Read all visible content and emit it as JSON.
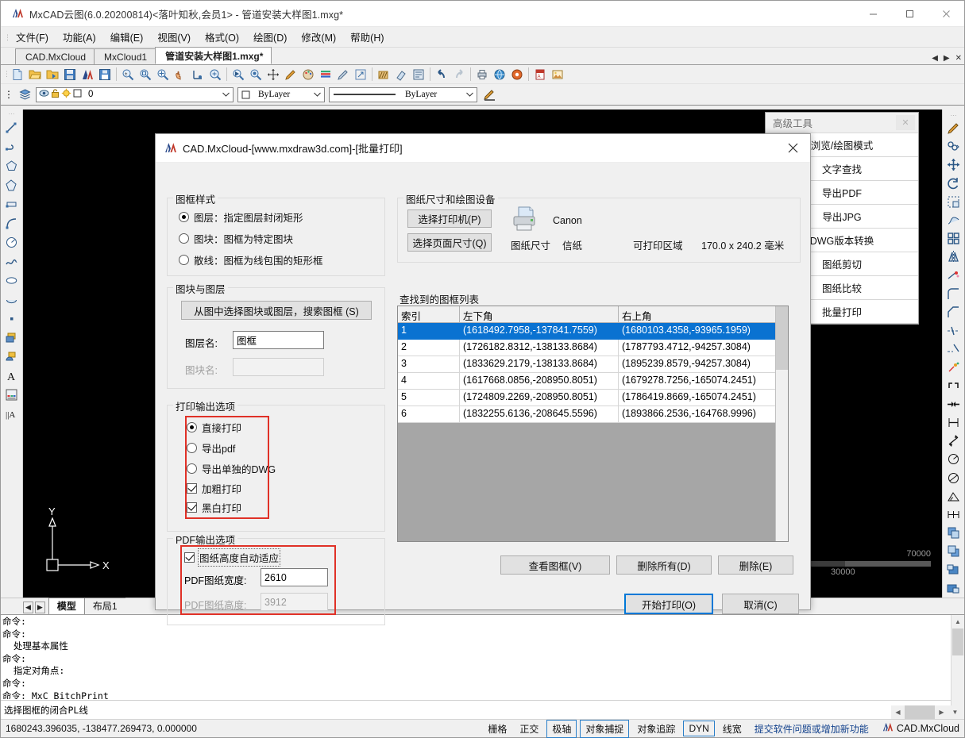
{
  "window": {
    "title": "MxCAD云图(6.0.20200814)<落叶知秋,会员1> - 管道安装大样图1.mxg*",
    "minimize": "—",
    "maximize": "□",
    "close": "✕"
  },
  "menubar": [
    {
      "label": "文件(F)"
    },
    {
      "label": "功能(A)"
    },
    {
      "label": "编辑(E)"
    },
    {
      "label": "视图(V)"
    },
    {
      "label": "格式(O)"
    },
    {
      "label": "绘图(D)"
    },
    {
      "label": "修改(M)"
    },
    {
      "label": "帮助(H)"
    }
  ],
  "doc_tabs": [
    {
      "label": "CAD.MxCloud",
      "active": false
    },
    {
      "label": "MxCloud1",
      "active": false
    },
    {
      "label": "管道安装大样图1.mxg*",
      "active": true
    }
  ],
  "tab_nav": {
    "prev": "◀",
    "next": "▶",
    "close": "✕"
  },
  "layer_toolbar": {
    "layer_value": "0",
    "color_value": "ByLayer",
    "linetype_value": "ByLayer",
    "dropdown_arrow": "⌄"
  },
  "advanced_panel": {
    "title": "高级工具",
    "close": "✕",
    "items": [
      {
        "label": "浏览/绘图模式"
      },
      {
        "label": "文字查找"
      },
      {
        "label": "导出PDF"
      },
      {
        "label": "导出JPG"
      },
      {
        "label": "DWG版本转换"
      },
      {
        "label": "图纸剪切"
      },
      {
        "label": "图纸比较"
      },
      {
        "label": "批量打印"
      }
    ]
  },
  "canvas": {
    "ucs_x": "X",
    "ucs_y": "Y",
    "scale_left": "000",
    "scale_right": "70000",
    "scale_mid": "30000"
  },
  "layout_tabs": {
    "nav_prev": "◀",
    "nav_next": "▶",
    "tabs": [
      {
        "label": "模型",
        "active": true
      },
      {
        "label": "布局1",
        "active": false
      }
    ]
  },
  "command_history": [
    "命令:",
    "命令:",
    "  处理基本属性",
    "命令:",
    "  指定对角点:",
    "命令:",
    "命令: MxC_BitchPrint",
    " 选择图框的闭合PL线"
  ],
  "statusbar": {
    "coordinates": "1680243.396035,  -138477.269473,  0.000000",
    "toggles": [
      {
        "label": "栅格",
        "boxed": false
      },
      {
        "label": "正交",
        "boxed": false
      },
      {
        "label": "极轴",
        "boxed": true
      },
      {
        "label": "对象捕捉",
        "boxed": true
      },
      {
        "label": "对象追踪",
        "boxed": false
      },
      {
        "label": "DYN",
        "boxed": true
      },
      {
        "label": "线宽",
        "boxed": false
      }
    ],
    "feedback_link": "提交软件问题或增加新功能",
    "brand": "CAD.MxCloud"
  },
  "dialog": {
    "title": "CAD.MxCloud-[www.mxdraw3d.com]-[批量打印]",
    "close": "✕",
    "frame_style": {
      "legend": "图框样式",
      "options": [
        {
          "label": "图层：指定图层封闭矩形",
          "selected": true
        },
        {
          "label": "图块：图框为特定图块",
          "selected": false
        },
        {
          "label": "散线：图框为线包围的矩形框",
          "selected": false
        }
      ]
    },
    "block_layer": {
      "legend": "图块与图层",
      "search_button": "从图中选择图块或图层，搜索图框 (S)",
      "layer_label": "图层名:",
      "layer_value": "图框",
      "block_label": "图块名:",
      "block_value": ""
    },
    "print_output": {
      "legend": "打印输出选项",
      "options": [
        {
          "type": "radio",
          "label": "直接打印",
          "checked": true
        },
        {
          "type": "radio",
          "label": "导出pdf",
          "checked": false
        },
        {
          "type": "radio",
          "label": "导出单独的DWG",
          "checked": false
        },
        {
          "type": "check",
          "label": "加粗打印",
          "checked": true
        },
        {
          "type": "check",
          "label": "黑白打印",
          "checked": true
        }
      ]
    },
    "pdf_output": {
      "legend": "PDF输出选项",
      "auto_height": {
        "label": "图纸高度自动适应",
        "checked": true
      },
      "width_label": "PDF图纸宽度:",
      "width_value": "2610",
      "height_label": "PDF图纸高度:",
      "height_value": "3912"
    },
    "paper_device": {
      "legend": "图纸尺寸和绘图设备",
      "select_printer_button": "选择打印机(P)",
      "select_pagesize_button": "选择页面尺寸(Q)",
      "printer_name": "Canon",
      "paper_size_label": "图纸尺寸",
      "paper_size_value": "信纸",
      "printable_area_label": "可打印区域",
      "printable_area_value": "170.0 x 240.2 毫米"
    },
    "frame_list": {
      "legend": "查找到的图框列表",
      "columns": [
        "索引",
        "左下角",
        "右上角"
      ],
      "rows": [
        {
          "index": "1",
          "lower_left": "(1618492.7958,-137841.7559)",
          "upper_right": "(1680103.4358,-93965.1959)",
          "selected": true
        },
        {
          "index": "2",
          "lower_left": "(1726182.8312,-138133.8684)",
          "upper_right": "(1787793.4712,-94257.3084)",
          "selected": false
        },
        {
          "index": "3",
          "lower_left": "(1833629.2179,-138133.8684)",
          "upper_right": "(1895239.8579,-94257.3084)",
          "selected": false
        },
        {
          "index": "4",
          "lower_left": "(1617668.0856,-208950.8051)",
          "upper_right": "(1679278.7256,-165074.2451)",
          "selected": false
        },
        {
          "index": "5",
          "lower_left": "(1724809.2269,-208950.8051)",
          "upper_right": "(1786419.8669,-165074.2451)",
          "selected": false
        },
        {
          "index": "6",
          "lower_left": "(1832255.6136,-208645.5596)",
          "upper_right": "(1893866.2536,-164768.9996)",
          "selected": false
        }
      ]
    },
    "list_buttons": [
      {
        "label": "查看图框(V)"
      },
      {
        "label": "删除所有(D)"
      },
      {
        "label": "删除(E)"
      }
    ],
    "action_buttons": [
      {
        "label": "开始打印(O)",
        "default": true
      },
      {
        "label": "取消(C)",
        "default": false
      }
    ]
  },
  "colors": {
    "selection_blue": "#0a72d1",
    "accent_blue": "#0078d7",
    "highlight_red": "#e03127",
    "canvas_black": "#000000",
    "chrome_gray": "#f0f0f0"
  }
}
